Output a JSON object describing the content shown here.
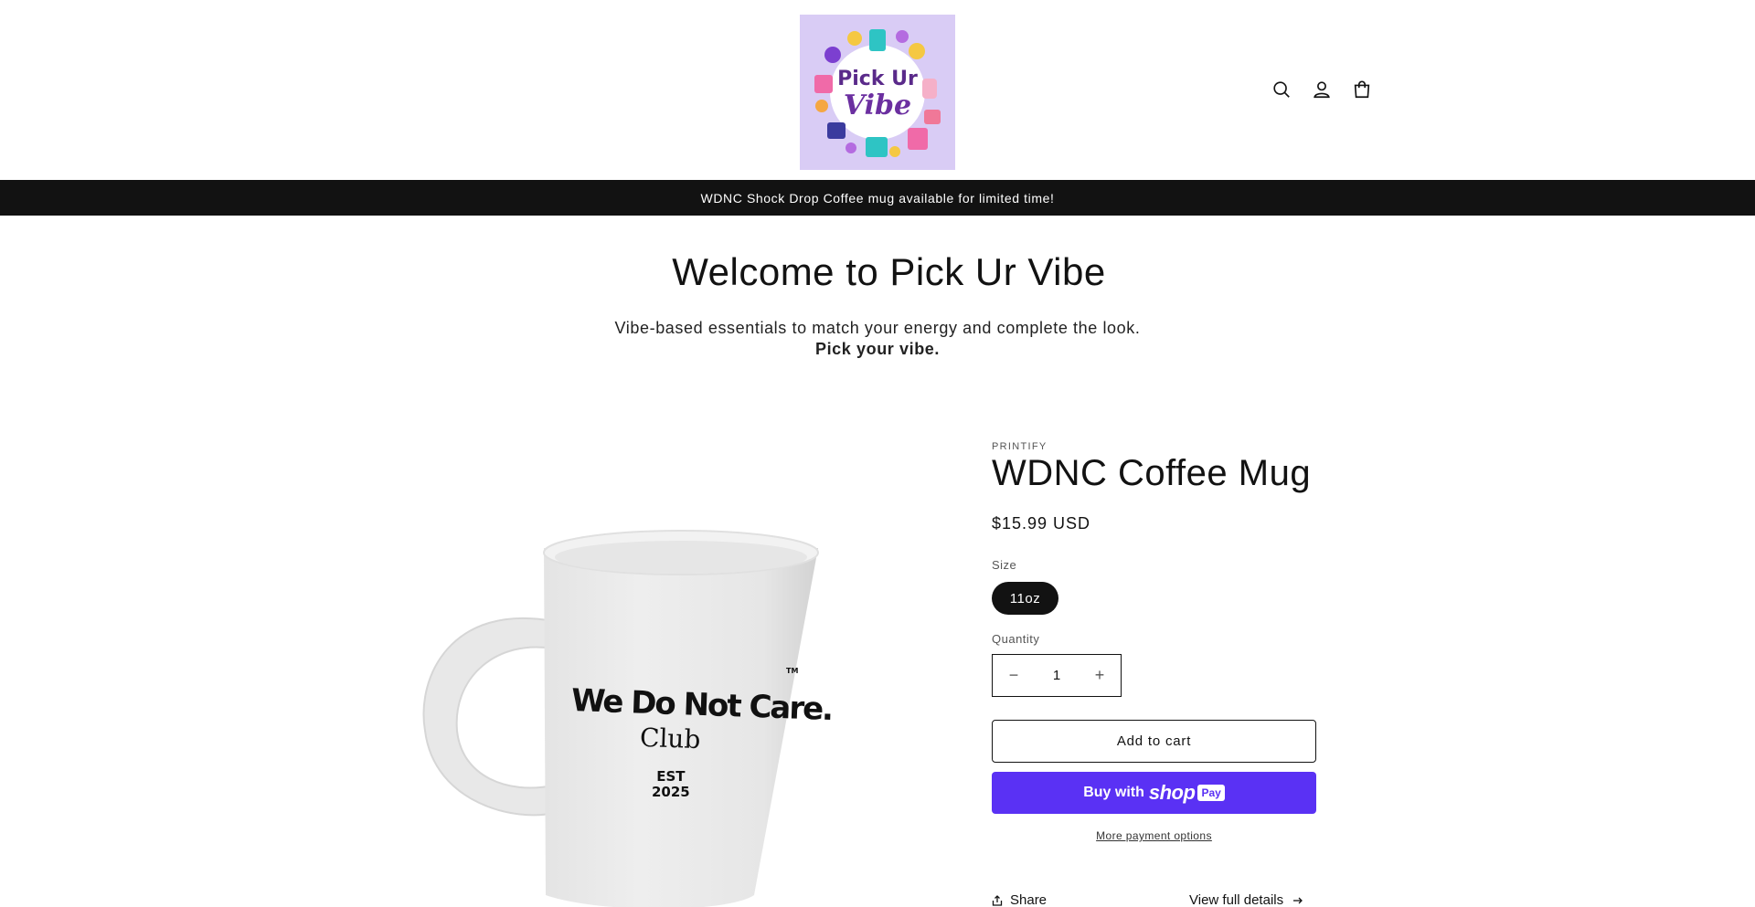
{
  "header": {
    "logo_line1": "Pick Ur",
    "logo_line2": "Vibe",
    "icons": [
      "search-icon",
      "account-icon",
      "cart-icon"
    ]
  },
  "announcement": {
    "text": "WDNC Shock Drop Coffee mug available for limited time!"
  },
  "welcome": {
    "title": "Welcome to Pick Ur Vibe",
    "subtitle": "Vibe-based essentials to match your energy and complete the look.",
    "tagline": "Pick your vibe."
  },
  "product": {
    "vendor": "PRINTIFY",
    "title": "WDNC Coffee Mug",
    "price": "$15.99 USD",
    "size_label": "Size",
    "size_selected": "11oz",
    "quantity_label": "Quantity",
    "quantity_value": "1",
    "decrease": "−",
    "increase": "+",
    "add_to_cart": "Add to cart",
    "buy_with": "Buy with",
    "shop": "shop",
    "pay": "Pay",
    "more_payment": "More payment options",
    "share": "Share",
    "view_details": "View full details",
    "mug_print": {
      "line1": "We Do Not Care.",
      "line2": "Club",
      "est": "EST",
      "year": "2025",
      "tm": "TM"
    }
  },
  "colors": {
    "announcement_bg": "#121212",
    "shop_pay": "#5a31f4",
    "logo_bg": "#d9ccf5"
  }
}
